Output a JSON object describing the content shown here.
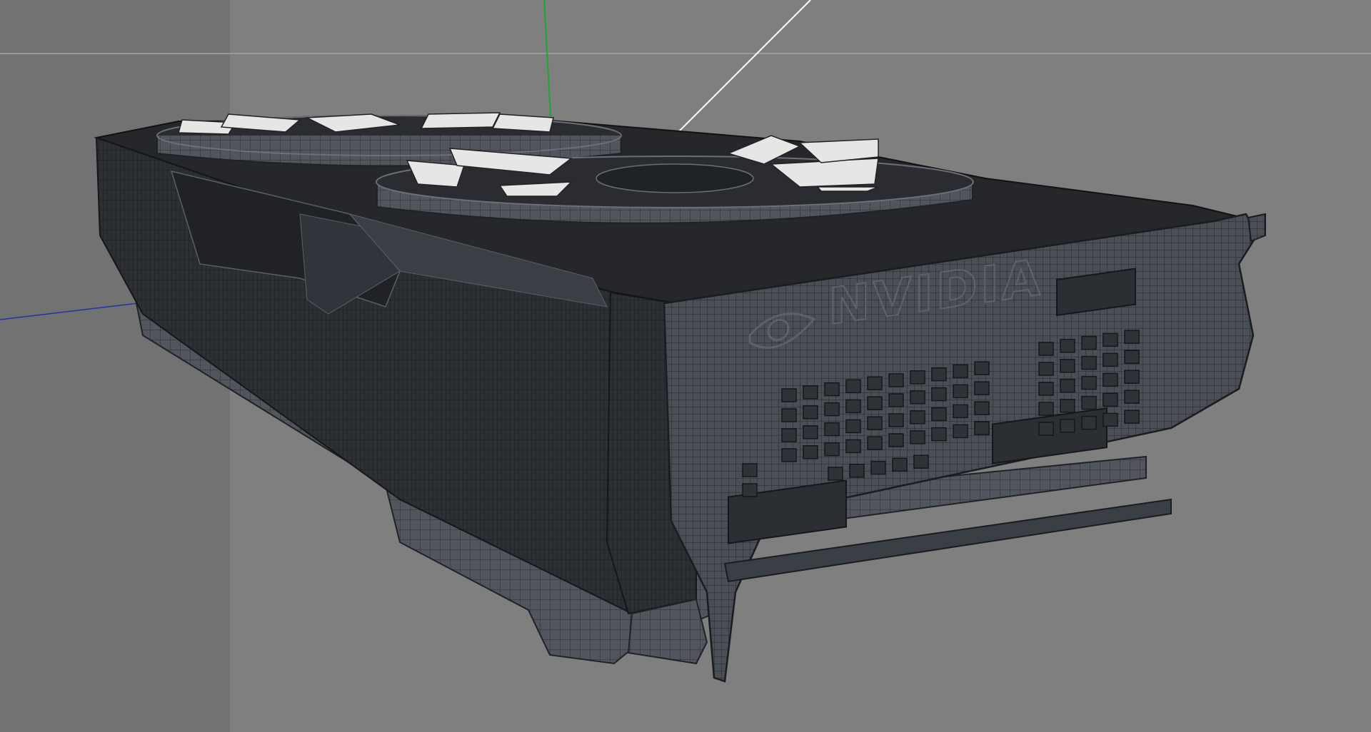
{
  "viewport": {
    "background": "#7f7f7f",
    "left_pane_color": "#727272",
    "axis_colors": {
      "x": "#2433a8",
      "y": "#1fa531",
      "z": "#ffffff"
    }
  },
  "model": {
    "brand_text": "NVIDIA",
    "brand_logo": "nvidia-eye-logo",
    "wire_color": "#1f2226",
    "surface_dark": "#2a2c31",
    "surface_mid": "#4b5058",
    "fan_blade_color": "#e6e6e6"
  }
}
